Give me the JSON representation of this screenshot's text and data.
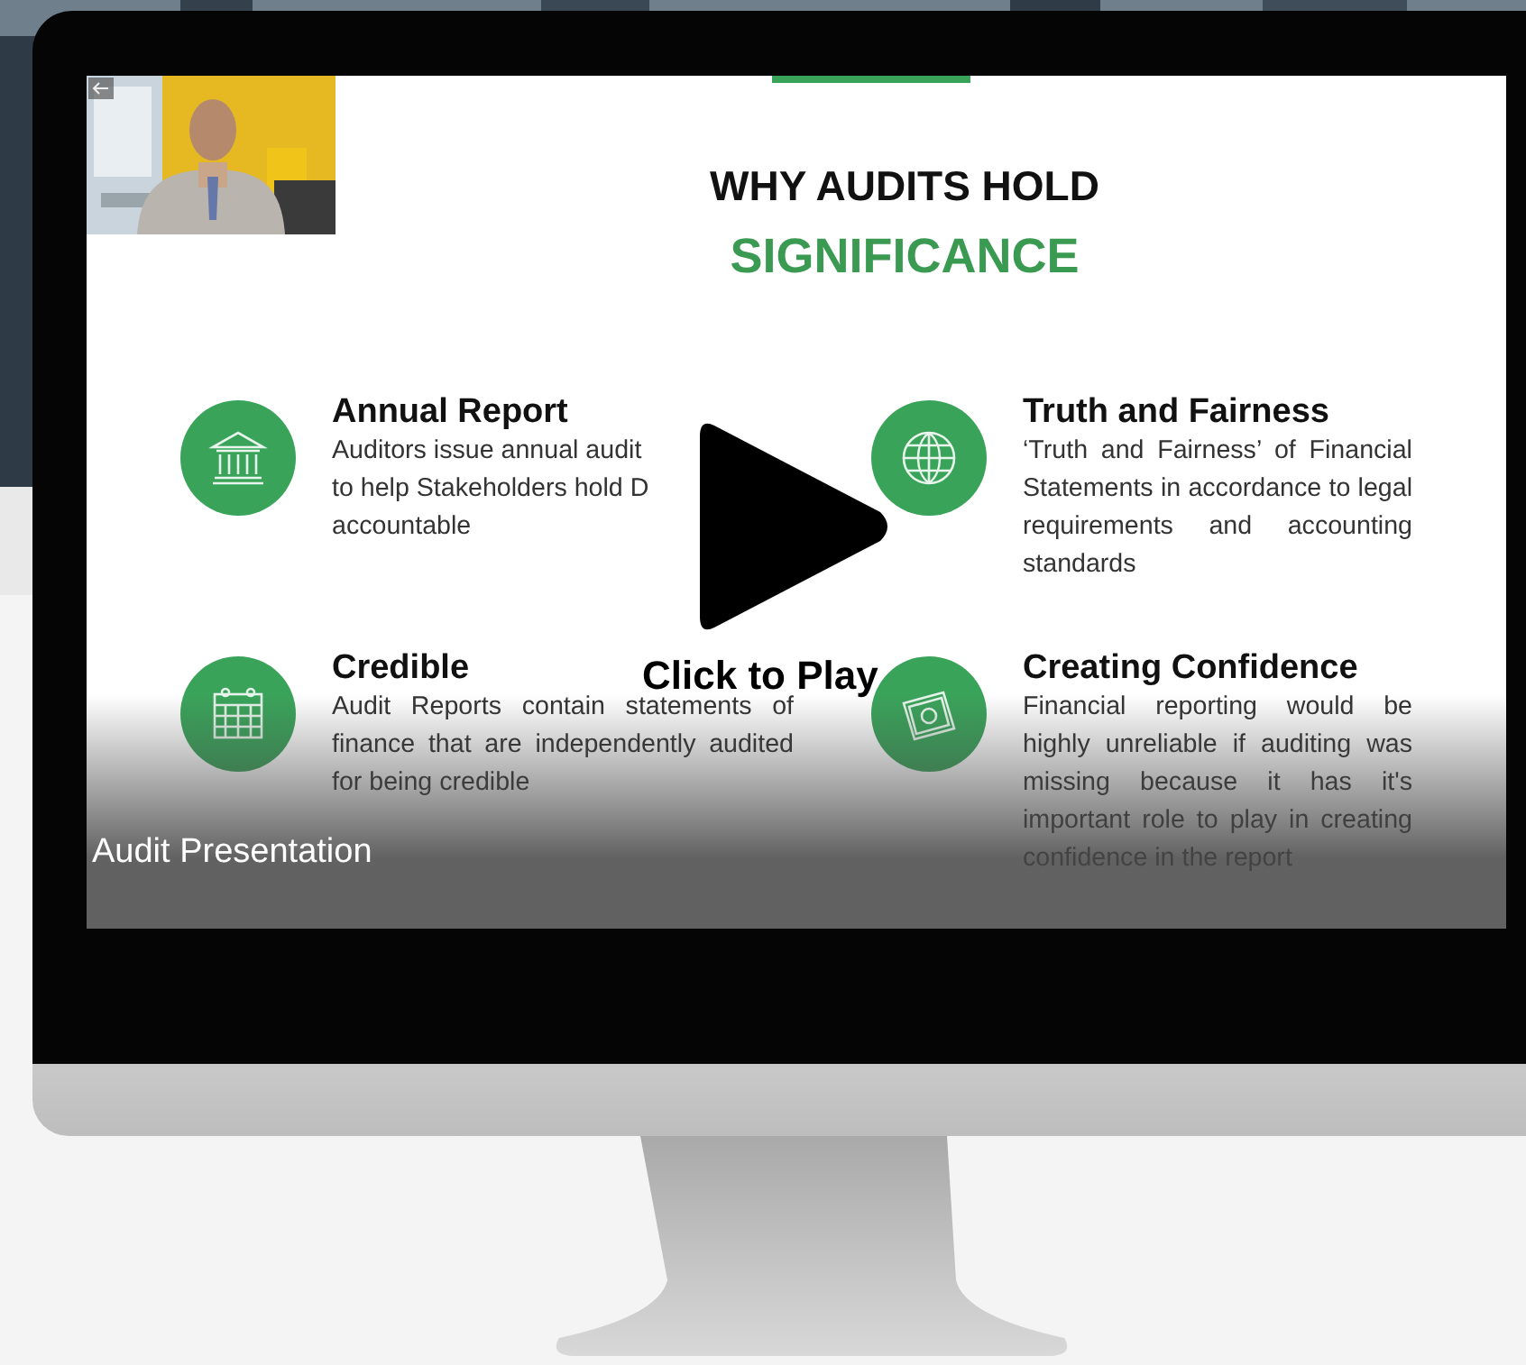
{
  "video": {
    "title": "Audit Presentation",
    "play_label": "Click to Play"
  },
  "slide": {
    "heading": "WHY AUDITS HOLD",
    "subheading": "SIGNIFICANCE",
    "items": [
      {
        "kind": "bank",
        "title": "Annual Report",
        "lines": [
          "Auditors issue annual audit",
          "to help Stakeholders hold D",
          "accountable"
        ]
      },
      {
        "kind": "globe",
        "title": "Truth and Fairness",
        "description": "‘Truth and Fairness’ of Financial Statements in accordance to legal requirements and accounting standards"
      },
      {
        "kind": "calendar",
        "title": "Credible",
        "description": "Audit Reports contain statements of finance that are independently audited for being credible"
      },
      {
        "kind": "banknote",
        "title": "Creating Confidence",
        "description": "Financial reporting would be highly unreliable if auditing was missing because it has it's important role to play in creating confidence in the report"
      }
    ]
  }
}
